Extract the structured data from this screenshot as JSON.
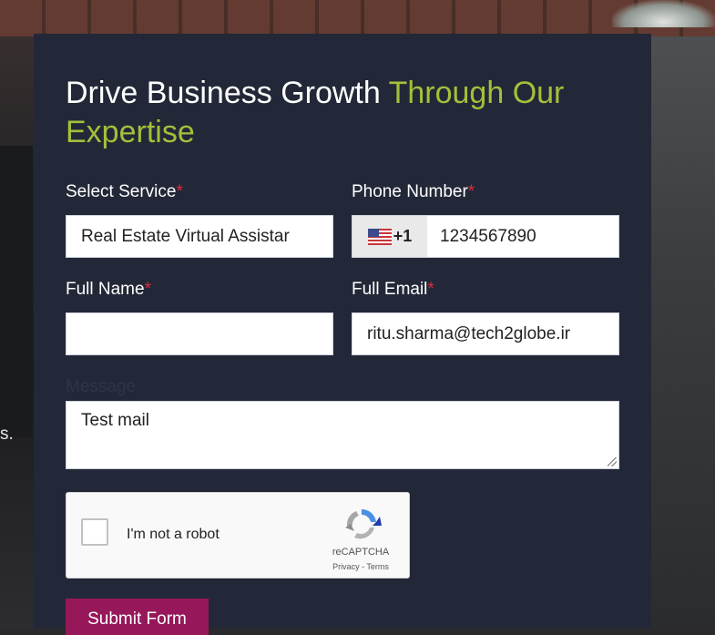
{
  "background": {
    "edge_text": "s."
  },
  "form": {
    "heading_main": "Drive Business Growth ",
    "heading_accent": "Through Our Expertise",
    "service": {
      "label": "Select Service",
      "required_mark": "*",
      "value": "Real Estate Virtual Assistar"
    },
    "phone": {
      "label": "Phone Number",
      "required_mark": "*",
      "country_code": "+1",
      "country_icon": "us-flag-icon",
      "value": "1234567890"
    },
    "full_name": {
      "label": "Full Name",
      "required_mark": "*",
      "value": ""
    },
    "email": {
      "label": "Full Email",
      "required_mark": "*",
      "value": "ritu.sharma@tech2globe.ir"
    },
    "message": {
      "label": "Message",
      "value": "Test mail"
    },
    "captcha": {
      "checkbox_label": "I'm not a robot",
      "brand": "reCAPTCHA",
      "privacy": "Privacy",
      "separator": " - ",
      "terms": "Terms"
    },
    "submit_label": "Submit Form"
  },
  "colors": {
    "panel": "#232838",
    "accent": "#a5bf3a",
    "required": "#e0283b",
    "submit": "#96185a"
  }
}
